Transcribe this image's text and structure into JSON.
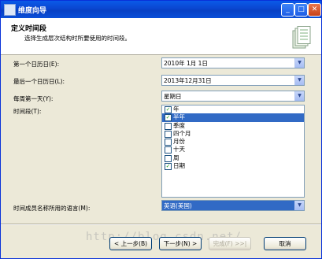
{
  "window": {
    "title": "维度向导"
  },
  "titlebar": {
    "minimize": "_",
    "maximize": "□",
    "close": "✕"
  },
  "header": {
    "title": "定义时间段",
    "subtitle": "选择生成层次结构时所要使用的时间段。",
    "icon": "time-dimension-icon"
  },
  "form": {
    "first_day_label": "第一个日历日(E):",
    "first_day_value": "2010年 1月 1日",
    "last_day_label": "最后一个日历日(L):",
    "last_day_value": "2013年12月31日",
    "week_start_label": "每周第一天(Y):",
    "week_start_value": "星期日",
    "periods_label": "时间段(T):",
    "periods": [
      {
        "label": "年",
        "checked": true,
        "selected": false
      },
      {
        "label": "半年",
        "checked": true,
        "selected": true
      },
      {
        "label": "季度",
        "checked": false,
        "selected": false
      },
      {
        "label": "四个月",
        "checked": false,
        "selected": false
      },
      {
        "label": "月份",
        "checked": false,
        "selected": false
      },
      {
        "label": "十天",
        "checked": false,
        "selected": false
      },
      {
        "label": "周",
        "checked": false,
        "selected": false
      },
      {
        "label": "日期",
        "checked": true,
        "selected": false
      }
    ],
    "language_label": "时间成员名称所用的语言(M):",
    "language_value": "英语(美国)"
  },
  "buttons": {
    "back": "< 上一步(B)",
    "next": "下一步(N) >",
    "finish": "完成(F) >>|",
    "cancel": "取消"
  },
  "watermark": "http://blog.csdn.net/"
}
